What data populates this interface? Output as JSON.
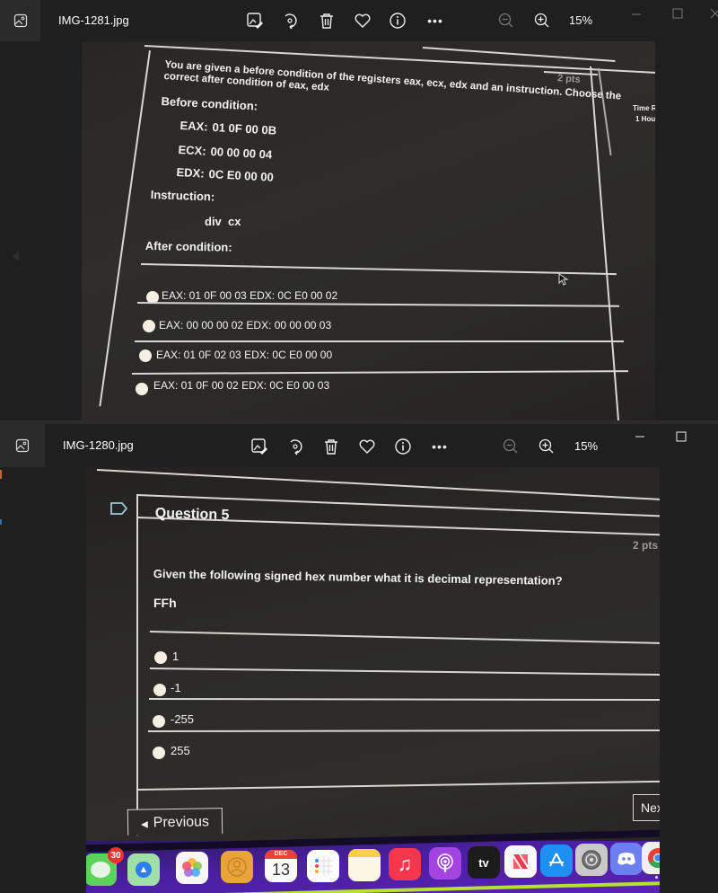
{
  "windows": [
    {
      "filename": "IMG-1281.jpg",
      "zoom_level": "15%",
      "toolbar": {
        "edit": "edit-image",
        "rotate": "rotate",
        "delete": "delete",
        "favorite": "favorite",
        "info": "info",
        "more": "•••",
        "zoom_out": "zoom-out",
        "zoom_in": "zoom-in"
      },
      "photo": {
        "pts": "2 pts",
        "question": "You are given a before condition of the registers eax, ecx, edx and an instruction. Choose the",
        "question_cont": "correct after condition of eax, edx",
        "before_label": "Before condition:",
        "registers": [
          {
            "name": "EAX:",
            "value": "01 0F 00 0B"
          },
          {
            "name": "ECX:",
            "value": "00 00 00 04"
          },
          {
            "name": "EDX:",
            "value": "0C E0 00 00"
          }
        ],
        "instruction_label": "Instruction:",
        "instruction": "div  cx",
        "after_label": "After condition:",
        "options": [
          "EAX: 01 0F 00 03 EDX: 0C E0 00 02",
          "EAX: 00 00 00 02 EDX: 00 00 00 03",
          "EAX: 01 0F 02 03 EDX: 0C E0 00 00",
          "EAX: 01 0F 00 02 EDX: 0C E0 00 03"
        ],
        "side_time": "Time R",
        "side_hours": "1 Hou"
      }
    },
    {
      "filename": "IMG-1280.jpg",
      "zoom_level": "15%",
      "toolbar": {
        "more": "•••"
      },
      "photo": {
        "question_title": "Question 5",
        "pts": "2 pts",
        "question": "Given the following signed hex number what it is decimal representation?",
        "hex_value": "FFh",
        "options": [
          "1",
          "-1",
          "-255",
          "255"
        ],
        "previous_label": "Previous",
        "next_label": "Nex",
        "dock": {
          "messages_badge": "30",
          "calendar_month": "DEC",
          "calendar_day": "13",
          "tv_label": "tv"
        }
      }
    }
  ]
}
